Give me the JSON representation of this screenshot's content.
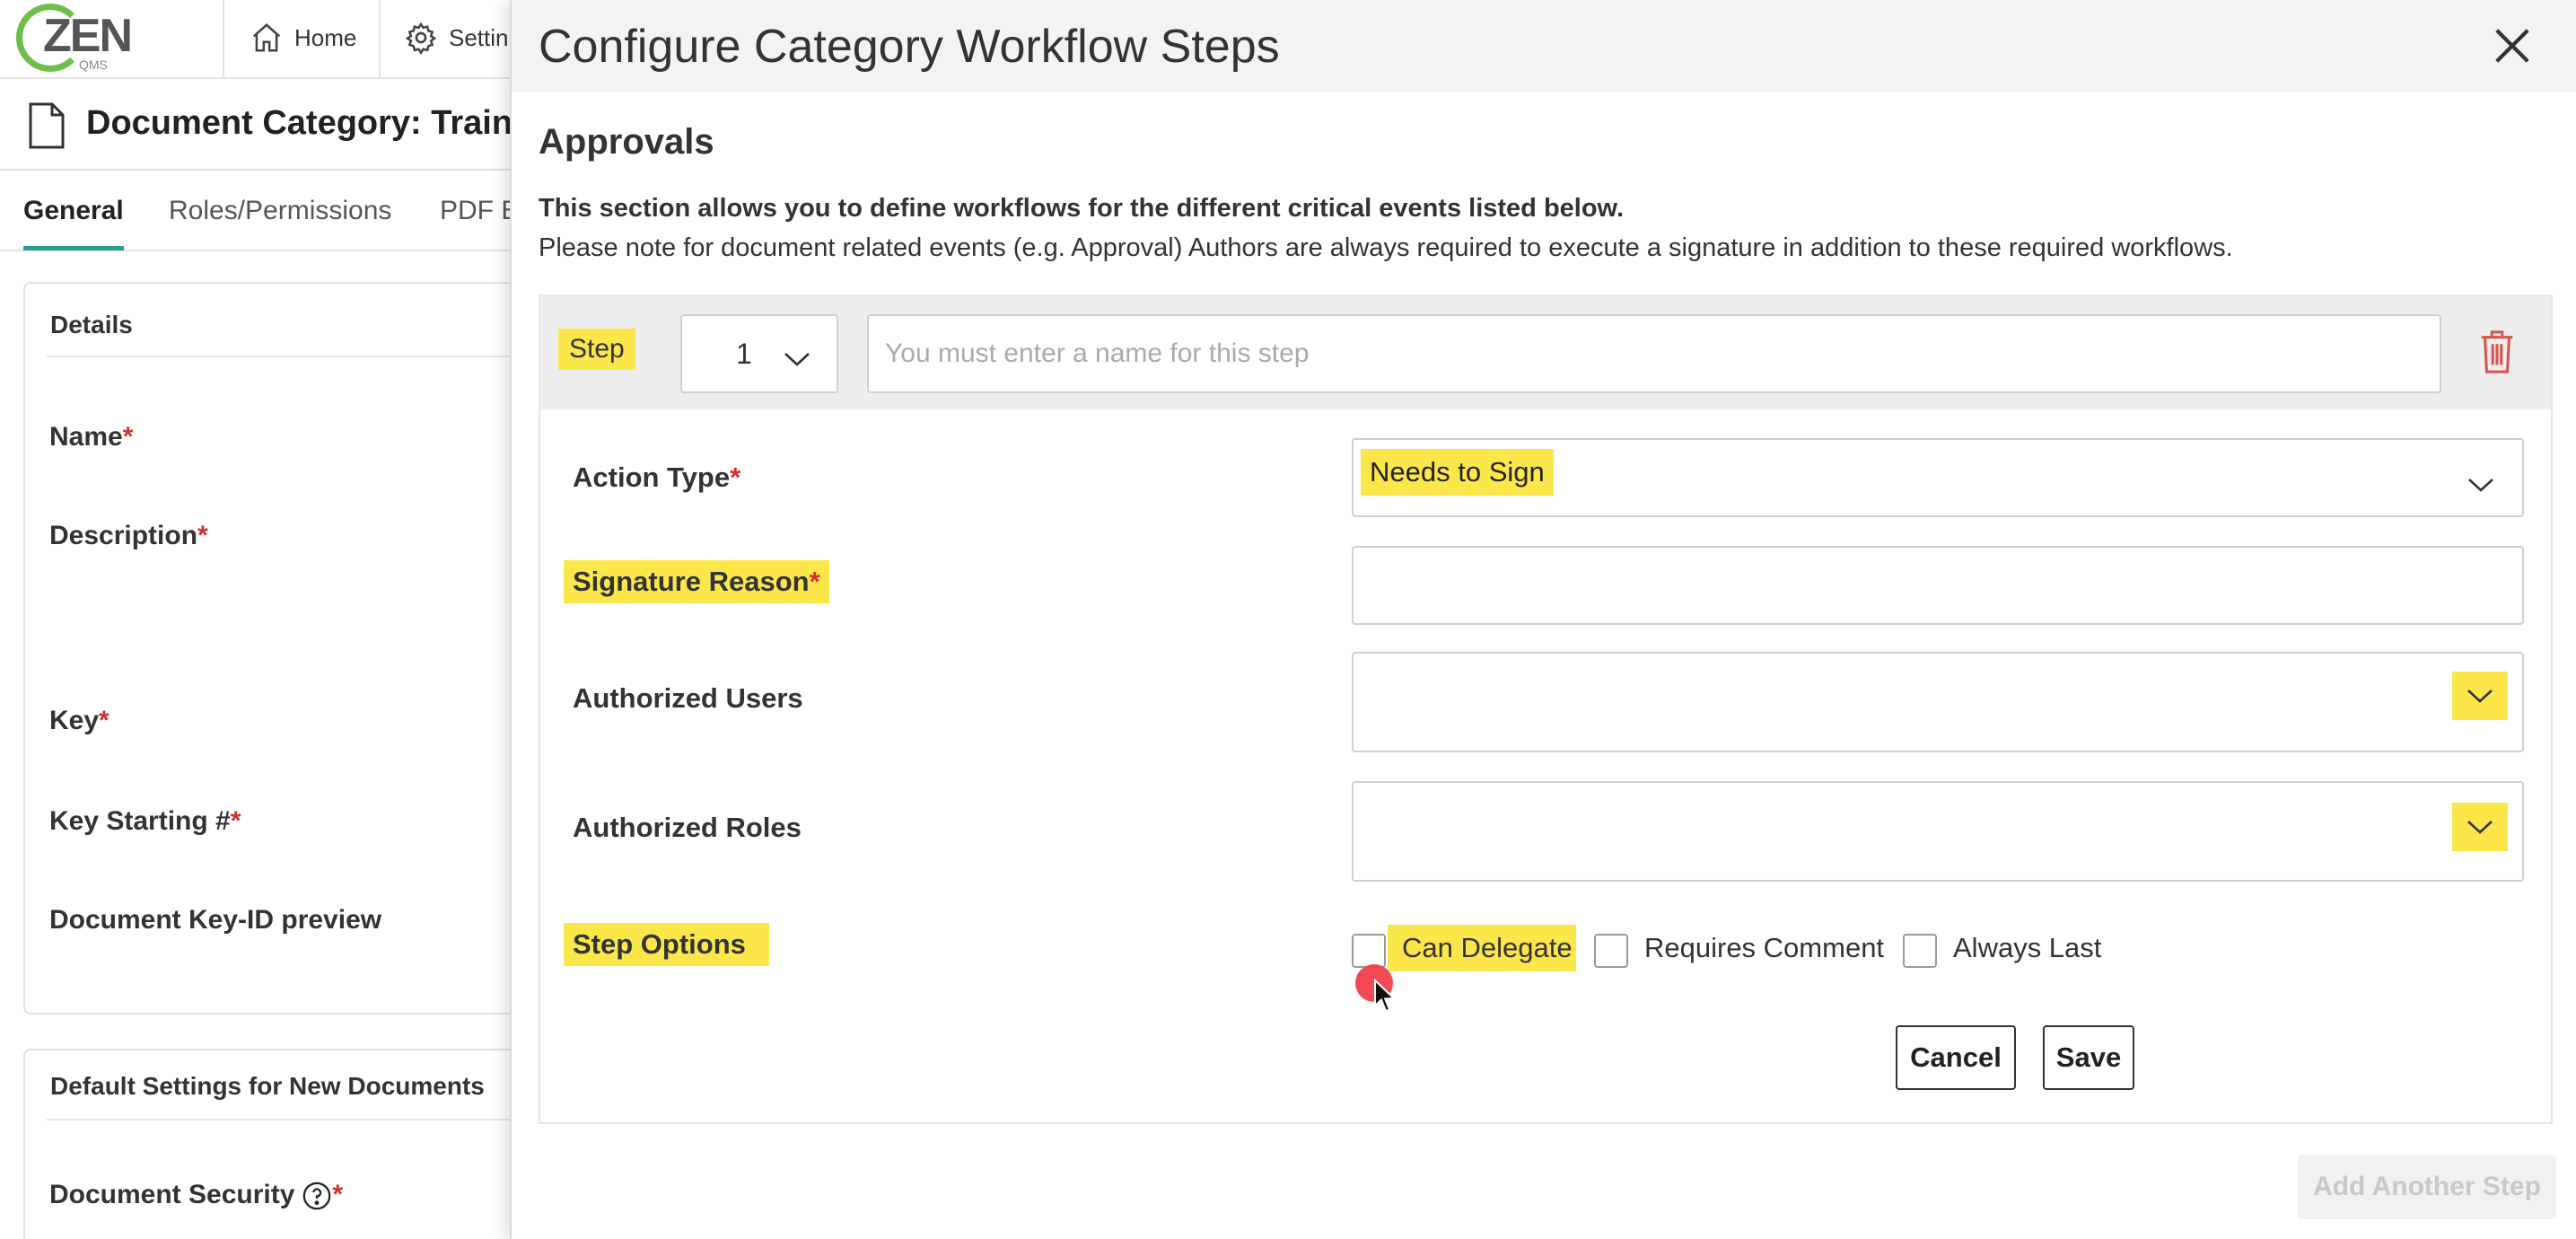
{
  "app": {
    "logo_text": "ZEN",
    "logo_sub": "QMS",
    "nav": [
      {
        "label": "Home",
        "icon": "home-icon"
      },
      {
        "label": "Settin",
        "icon": "gear-icon"
      }
    ]
  },
  "document": {
    "title": "Document Category: Traini",
    "tabs": [
      {
        "label": "General",
        "active": true
      },
      {
        "label": "Roles/Permissions",
        "active": false
      },
      {
        "label": "PDF E",
        "active": false
      }
    ],
    "details": {
      "heading": "Details",
      "fields": [
        {
          "label": "Name",
          "required": "*"
        },
        {
          "label": "Description",
          "required": "*"
        },
        {
          "label": "Key",
          "required": "*"
        },
        {
          "label": "Key Starting #",
          "required": "*"
        },
        {
          "label": "Document Key-ID preview",
          "required": ""
        }
      ]
    },
    "defaults": {
      "heading": "Default Settings for New Documents",
      "security_label": "Document Security",
      "security_required": "*"
    }
  },
  "modal": {
    "title": "Configure Category Workflow Steps",
    "section_title": "Approvals",
    "intro_bold": "This section allows you to define workflows for the different critical events listed below.",
    "intro_text": "Please note for document related events (e.g. Approval) Authors are always required to execute a signature in addition to these required workflows.",
    "step": {
      "label": "Step",
      "number": "1",
      "name_value": "",
      "name_placeholder": "You must enter a name for this step",
      "action_type_label": "Action Type",
      "action_type_required": "*",
      "action_type_value": "Needs to Sign",
      "signature_reason_label": "Signature Reason",
      "signature_reason_required": "*",
      "signature_reason_value": "",
      "authorized_users_label": "Authorized Users",
      "authorized_roles_label": "Authorized Roles",
      "step_options_label": "Step Options",
      "options": [
        {
          "label": "Can Delegate",
          "checked": false
        },
        {
          "label": "Requires Comment",
          "checked": false
        },
        {
          "label": "Always Last",
          "checked": false
        }
      ]
    },
    "buttons": {
      "cancel": "Cancel",
      "save": "Save",
      "add_step": "Add Another Step"
    }
  },
  "colors": {
    "highlight": "#fbe74a",
    "accent_green": "#6cbf4a",
    "tab_underline": "#2a9d8f",
    "required": "#d32f2f",
    "trash": "#d9534f",
    "cursor": "#f0404a"
  }
}
